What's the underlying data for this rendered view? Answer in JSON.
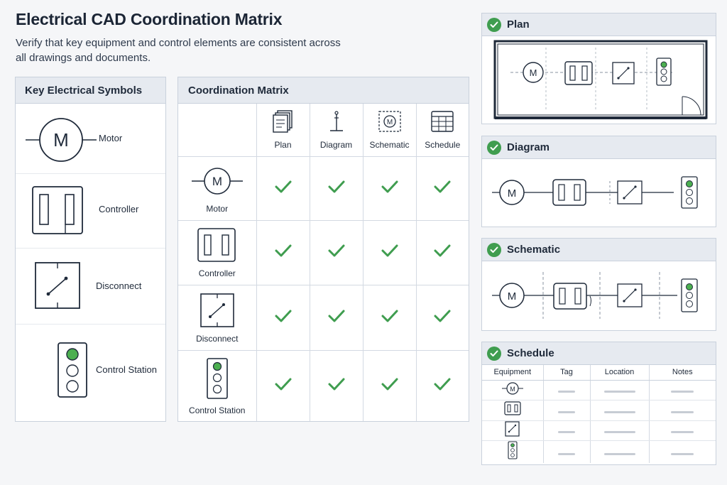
{
  "header": {
    "title": "Electrical CAD Coordination Matrix",
    "subtitle": "Verify that key equipment and control elements are consistent across all drawings and documents."
  },
  "key_panel": {
    "title": "Key Electrical Symbols",
    "items": [
      {
        "label": "Motor",
        "icon": "motor-icon"
      },
      {
        "label": "Controller",
        "icon": "controller-icon"
      },
      {
        "label": "Disconnect",
        "icon": "disconnect-icon"
      },
      {
        "label": "Control Station",
        "icon": "control-station-icon"
      }
    ]
  },
  "matrix": {
    "title": "Coordination Matrix",
    "columns": [
      {
        "label": "Plan",
        "icon": "plan-sheets-icon"
      },
      {
        "label": "Diagram",
        "icon": "diagram-icon"
      },
      {
        "label": "Schematic",
        "icon": "schematic-icon"
      },
      {
        "label": "Schedule",
        "icon": "schedule-grid-icon"
      }
    ],
    "rows": [
      {
        "label": "Motor",
        "checks": [
          true,
          true,
          true,
          true
        ]
      },
      {
        "label": "Controller",
        "checks": [
          true,
          true,
          true,
          true
        ]
      },
      {
        "label": "Disconnect",
        "checks": [
          true,
          true,
          true,
          true
        ]
      },
      {
        "label": "Control Station",
        "checks": [
          true,
          true,
          true,
          true
        ]
      }
    ]
  },
  "previews": {
    "plan": {
      "title": "Plan"
    },
    "diagram": {
      "title": "Diagram"
    },
    "schematic": {
      "title": "Schematic"
    },
    "schedule": {
      "title": "Schedule",
      "headers": [
        "Equipment",
        "Tag",
        "Location",
        "Notes"
      ]
    }
  },
  "symbol_text": {
    "motor": "M"
  },
  "colors": {
    "check_green": "#3f9d4f",
    "station_green": "#4caf50",
    "panel_header": "#e6eaf0",
    "ink": "#1f2a3a"
  }
}
